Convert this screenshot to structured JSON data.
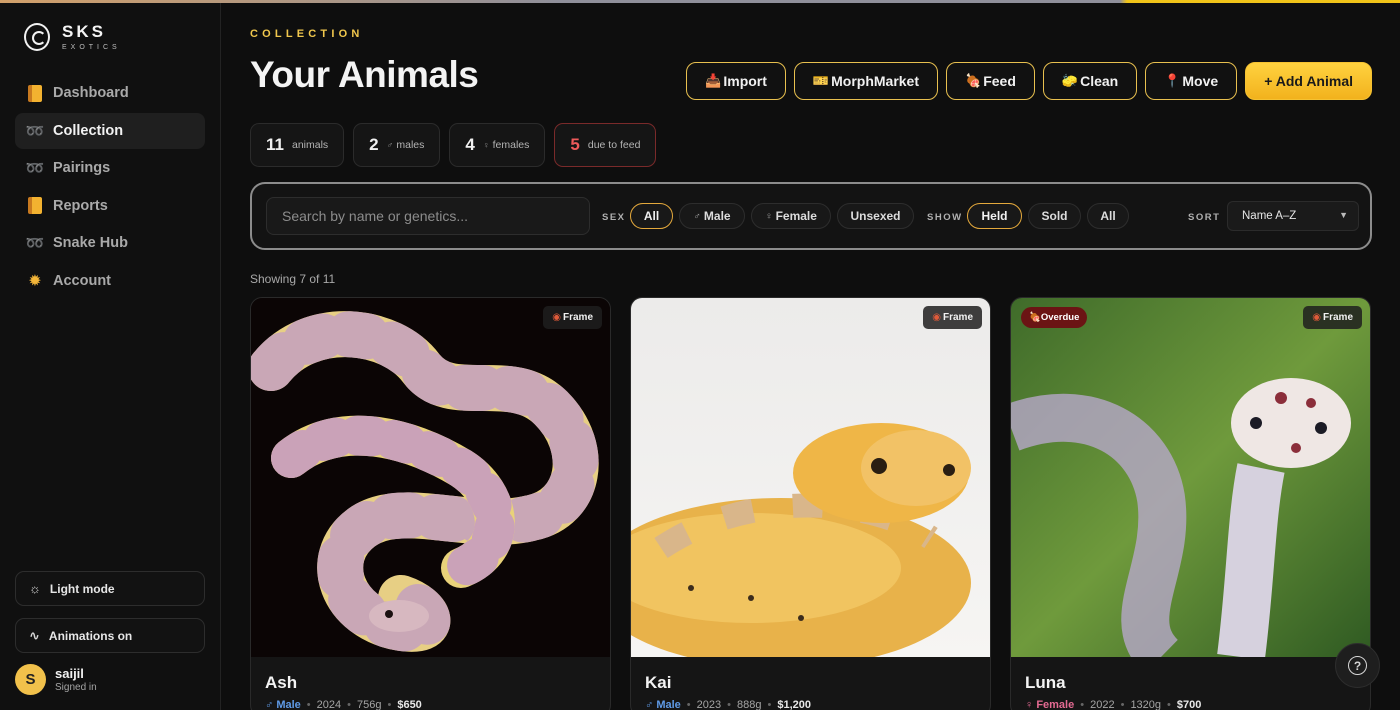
{
  "brand": {
    "name": "SKS",
    "tagline": "EXOTICS"
  },
  "sidebar": {
    "items": [
      {
        "label": "Dashboard",
        "icon": "book-icon"
      },
      {
        "label": "Collection",
        "icon": "snake-icon",
        "active": true
      },
      {
        "label": "Pairings",
        "icon": "snake-icon"
      },
      {
        "label": "Reports",
        "icon": "book-icon"
      },
      {
        "label": "Snake Hub",
        "icon": "snake-icon"
      },
      {
        "label": "Account",
        "icon": "star-icon"
      }
    ],
    "light_mode_label": "Light mode",
    "animations_label": "Animations on",
    "user": {
      "initial": "S",
      "name": "saijil",
      "status": "Signed in"
    }
  },
  "header": {
    "eyebrow": "COLLECTION",
    "title": "Your Animals",
    "actions": {
      "import": "Import",
      "morphmarket": "MorphMarket",
      "feed": "Feed",
      "clean": "Clean",
      "move": "Move",
      "add": "+ Add Animal"
    }
  },
  "stats": [
    {
      "value": "11",
      "label": "animals"
    },
    {
      "value": "2",
      "label": "males",
      "icon": "male-icon"
    },
    {
      "value": "4",
      "label": "females",
      "icon": "female-icon"
    },
    {
      "value": "5",
      "label": "due to feed",
      "alert": true
    }
  ],
  "filters": {
    "search_placeholder": "Search by name or genetics...",
    "sex_label": "SEX",
    "sex_options": [
      "All",
      "Male",
      "Female",
      "Unsexed"
    ],
    "sex_selected": "All",
    "show_label": "SHOW",
    "show_options": [
      "Held",
      "Sold",
      "All"
    ],
    "show_selected": "Held",
    "sort_label": "SORT",
    "sort_value": "Name A–Z"
  },
  "showing_text": "Showing 7 of 11",
  "cards": [
    {
      "name": "Ash",
      "sex": "Male",
      "year": "2024",
      "weight": "756g",
      "price": "$650",
      "badge": "Frame"
    },
    {
      "name": "Kai",
      "sex": "Male",
      "year": "2023",
      "weight": "888g",
      "price": "$1,200",
      "badge": "Frame"
    },
    {
      "name": "Luna",
      "sex": "Female",
      "year": "2022",
      "weight": "1320g",
      "price": "$700",
      "badge": "Frame",
      "status_badge": "Overdue"
    }
  ],
  "colors": {
    "accent": "#f0c74d",
    "alert": "#ee5a5a",
    "male": "#5f9ae6",
    "female": "#e46a92"
  }
}
